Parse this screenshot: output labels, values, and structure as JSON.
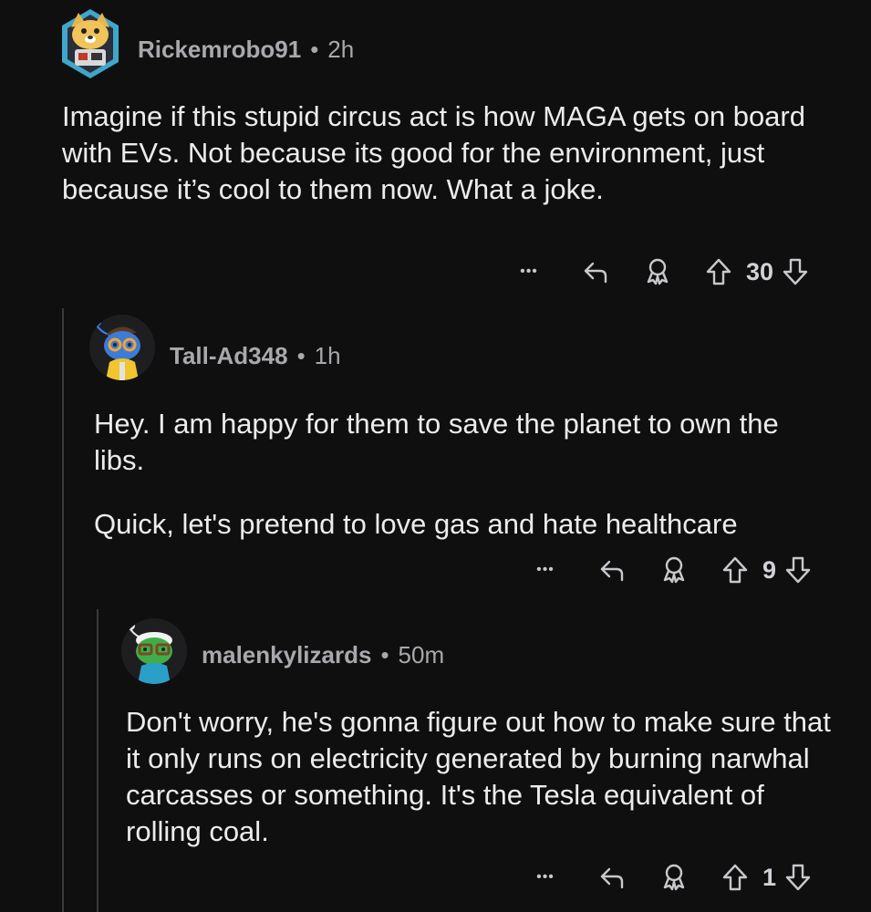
{
  "comments": [
    {
      "username": "Rickemrobo91",
      "separator": "•",
      "time": "2h",
      "body": [
        "Imagine if this stupid circus act is how MAGA gets on board with EVs. Not because its good for the environment, just because it’s cool to them now. What a joke."
      ],
      "score": "30",
      "avatar_icon": "dog-avatar-icon"
    },
    {
      "username": "Tall-Ad348",
      "separator": "•",
      "time": "1h",
      "body": [
        "Hey. I am happy for them to save the planet to own the libs.",
        "Quick, let's pretend to love gas and hate healthcare"
      ],
      "score": "9",
      "avatar_icon": "snoo-glasses-avatar-icon"
    },
    {
      "username": "malenkylizards",
      "separator": "•",
      "time": "50m",
      "body": [
        "Don't worry, he's gonna figure out how to make sure that it only runs on electricity generated by burning narwhal carcasses or something. It's the Tesla equivalent of rolling coal."
      ],
      "score": "1",
      "avatar_icon": "snoo-green-avatar-icon"
    }
  ],
  "actions": {
    "more_label": "•••"
  },
  "colors": {
    "background": "#0f0f10",
    "text": "#ececec",
    "meta": "#a9a9ad",
    "thread_line": "#3a3a3c"
  }
}
